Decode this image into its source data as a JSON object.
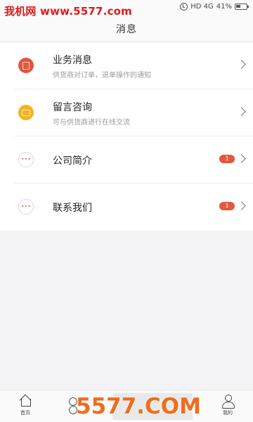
{
  "status_bar": {
    "watermark": "我机网 www.5577.com",
    "network": "HD 4G",
    "battery": "41%"
  },
  "header": {
    "title": "消息"
  },
  "messages": [
    {
      "title": "业务消息",
      "subtitle": "供货商对订单，退单操作的通知",
      "icon": "document-icon",
      "color": "#e2563b"
    },
    {
      "title": "留言咨询",
      "subtitle": "可与供货商进行在线交流",
      "icon": "chat-icon",
      "color": "#f0b521"
    },
    {
      "title": "公司简介",
      "badge": "1",
      "icon": "more-icon"
    },
    {
      "title": "联系我们",
      "badge": "1",
      "icon": "more-icon"
    }
  ],
  "bottom_nav": {
    "home_label": "首页",
    "mine_label": "我的"
  },
  "brand_watermark": "5577.COM"
}
